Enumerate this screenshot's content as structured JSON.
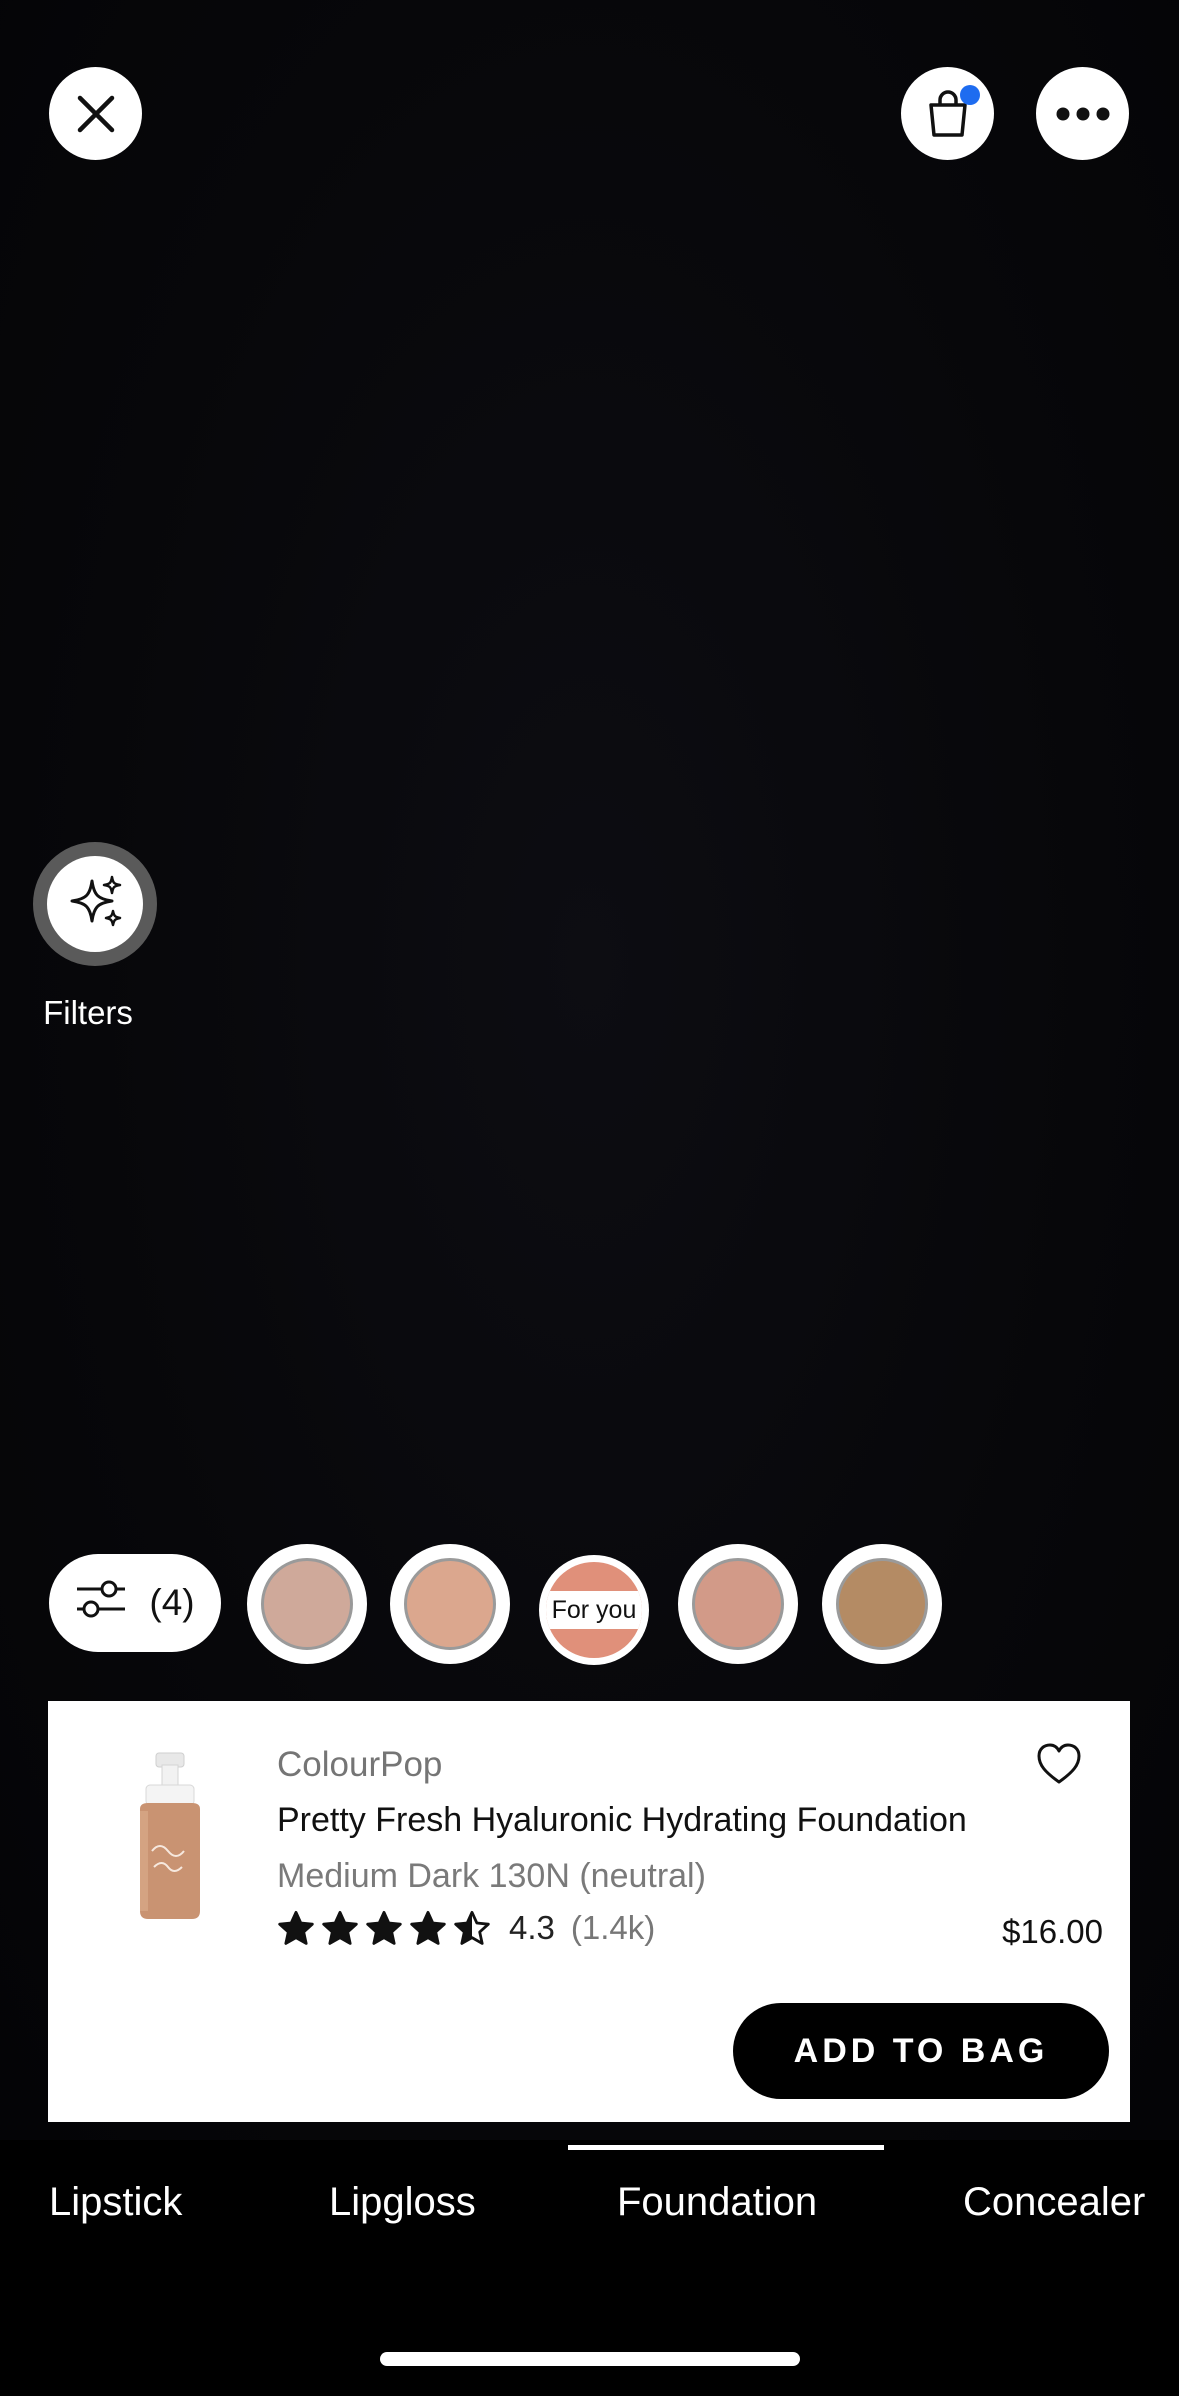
{
  "top_bar": {
    "close_icon": "close-icon",
    "bag_icon": "shopping-bag-icon",
    "bag_has_items": true,
    "more_icon": "more-icon"
  },
  "filters": {
    "label": "Filters",
    "icon": "sparkles-icon"
  },
  "shades": {
    "adjust_count": "(4)",
    "adjust_icon": "sliders-icon",
    "swatches": [
      "#cfa99a",
      "#dba78e",
      "#e0907a",
      "#d29a88",
      "#b48b64"
    ],
    "for_you_label": "For you"
  },
  "product": {
    "brand": "ColourPop",
    "name": "Pretty Fresh Hyaluronic Hydrating Foundation",
    "shade": "Medium Dark 130N (neutral)",
    "rating": "4.3",
    "rating_value": 4.3,
    "review_count": "(1.4k)",
    "price": "$16.00",
    "add_to_bag": "ADD TO BAG",
    "favorite_icon": "heart-icon"
  },
  "tabs": {
    "items": [
      "Lipstick",
      "Lipgloss",
      "Foundation",
      "Concealer"
    ],
    "active": "Foundation"
  }
}
